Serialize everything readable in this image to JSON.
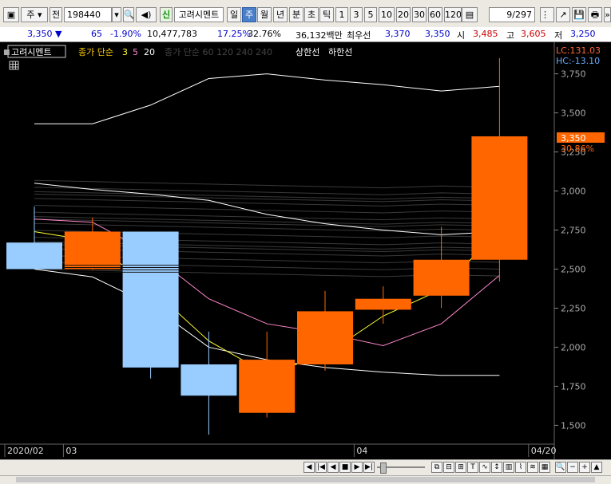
{
  "toolbar": {
    "market": "주",
    "prev_label": "전",
    "code": "198440",
    "company": "고려시멘트",
    "new_badge": "신",
    "periods": [
      "일",
      "주",
      "월",
      "년",
      "분",
      "초",
      "틱"
    ],
    "active_period": "주",
    "intervals": [
      "1",
      "3",
      "5",
      "10",
      "20",
      "30",
      "60",
      "120"
    ],
    "page": "9/297"
  },
  "quote": {
    "price": "3,350",
    "change": "65",
    "change_pct": "-1.90%",
    "volume": "10,477,783",
    "ratio1": "17.25%",
    "ratio2": "32.76%",
    "amount": "36,132백만",
    "best_ask_label": "최우선",
    "best_ask": "3,370",
    "best_bid": "3,350",
    "open_label": "시",
    "open": "3,485",
    "high_label": "고",
    "high": "3,605",
    "low_label": "저",
    "low": "3,250"
  },
  "legend": {
    "company": "고려시멘트",
    "ma_label": "종가 단순",
    "ma_periods": [
      "3",
      "5",
      "20"
    ],
    "ma_hidden": "종가 단순 60  120  240  240",
    "upper_limit": "상한선",
    "lower_limit": "하한선"
  },
  "readouts": {
    "lc": "LC:131.03",
    "hc": "HC:-13.10",
    "current_price": "3,350",
    "current_pct": "30.86%"
  },
  "colors": {
    "up": "#ff6600",
    "down": "#99ccff",
    "ma3": "#ffff33",
    "ma5": "#ff88cc",
    "ma20": "#ffffff"
  },
  "chart_data": {
    "type": "candlestick",
    "y_ticks": [
      "3,750",
      "3,500",
      "3,250",
      "3,000",
      "2,750",
      "2,500",
      "2,250",
      "2,000",
      "1,750",
      "1,500"
    ],
    "ylim": [
      1400,
      3850
    ],
    "x_labels": [
      {
        "label": "2020/02",
        "index": 0
      },
      {
        "label": "03",
        "index": 1
      },
      {
        "label": "04",
        "index": 6
      },
      {
        "label": "04/20",
        "index": 9
      }
    ],
    "candles": [
      {
        "open": 2670,
        "high": 2900,
        "low": 2500,
        "close": 2500
      },
      {
        "open": 2500,
        "high": 2830,
        "low": 2490,
        "close": 2740
      },
      {
        "open": 2740,
        "high": 2740,
        "low": 1800,
        "close": 1870
      },
      {
        "open": 1890,
        "high": 2100,
        "low": 1440,
        "close": 1690
      },
      {
        "open": 1580,
        "high": 2100,
        "low": 1550,
        "close": 1920
      },
      {
        "open": 1890,
        "high": 2360,
        "low": 1850,
        "close": 2230
      },
      {
        "open": 2240,
        "high": 2390,
        "low": 2150,
        "close": 2310
      },
      {
        "open": 2330,
        "high": 2770,
        "low": 2250,
        "close": 2560
      },
      {
        "open": 2560,
        "high": 3850,
        "low": 2420,
        "close": 3350
      }
    ],
    "series": [
      {
        "name": "3",
        "values": [
          2740,
          2680,
          2380,
          2040,
          1830,
          1950,
          2200,
          2370,
          2750
        ]
      },
      {
        "name": "5",
        "values": [
          2820,
          2800,
          2600,
          2310,
          2150,
          2090,
          2010,
          2150,
          2460
        ]
      },
      {
        "name": "20",
        "values": [
          3050,
          3010,
          2980,
          2940,
          2850,
          2790,
          2750,
          2720,
          2740
        ]
      }
    ],
    "upper_limit": [
      3430,
      3430,
      3550,
      3720,
      3750,
      3710,
      3680,
      3640,
      3670
    ],
    "lower_limit": [
      2500,
      2450,
      2270,
      2000,
      1920,
      1870,
      1840,
      1820,
      1820
    ]
  }
}
